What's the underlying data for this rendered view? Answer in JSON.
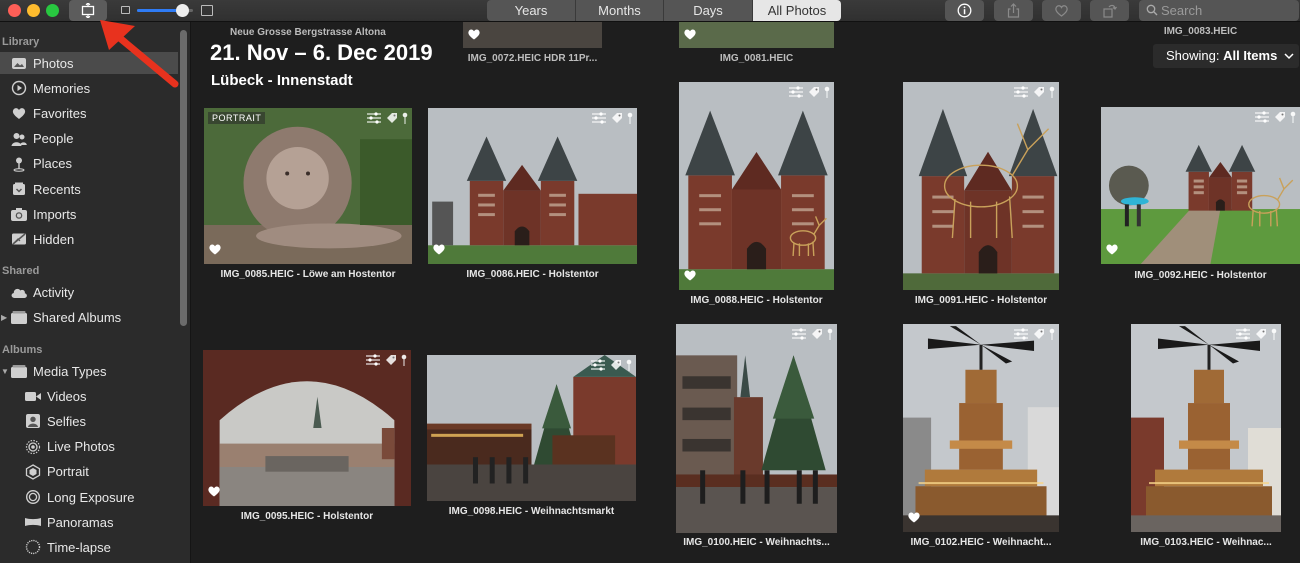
{
  "toolbar": {
    "tabs": [
      {
        "label": "Years",
        "active": false
      },
      {
        "label": "Months",
        "active": false
      },
      {
        "label": "Days",
        "active": false
      },
      {
        "label": "All Photos",
        "active": true
      }
    ],
    "search_placeholder": "Search",
    "zoom_level": 0.8
  },
  "sidebar": {
    "library_header": "Library",
    "library_items": [
      {
        "label": "Photos",
        "icon": "photos-icon",
        "selected": true
      },
      {
        "label": "Memories",
        "icon": "memories-icon"
      },
      {
        "label": "Favorites",
        "icon": "heart-icon"
      },
      {
        "label": "People",
        "icon": "people-icon"
      },
      {
        "label": "Places",
        "icon": "pin-icon"
      },
      {
        "label": "Recents",
        "icon": "recents-icon"
      },
      {
        "label": "Imports",
        "icon": "camera-icon"
      },
      {
        "label": "Hidden",
        "icon": "hidden-icon"
      }
    ],
    "shared_header": "Shared",
    "shared_items": [
      {
        "label": "Activity",
        "icon": "cloud-icon"
      },
      {
        "label": "Shared Albums",
        "icon": "folder-icon",
        "disclosure": true
      }
    ],
    "albums_header": "Albums",
    "albums_items": [
      {
        "label": "Media Types",
        "icon": "folder-icon",
        "disclosure": true,
        "expanded": true
      },
      {
        "label": "Videos",
        "icon": "video-icon",
        "sub": true
      },
      {
        "label": "Selfies",
        "icon": "selfie-icon",
        "sub": true
      },
      {
        "label": "Live Photos",
        "icon": "live-icon",
        "sub": true
      },
      {
        "label": "Portrait",
        "icon": "portrait-icon",
        "sub": true
      },
      {
        "label": "Long Exposure",
        "icon": "exposure-icon",
        "sub": true
      },
      {
        "label": "Panoramas",
        "icon": "panorama-icon",
        "sub": true
      },
      {
        "label": "Time-lapse",
        "icon": "timelapse-icon",
        "sub": true
      }
    ]
  },
  "main": {
    "location_small": "Neue Grosse Bergstrasse Altona",
    "date_range": "21. Nov – 6. Dec 2019",
    "location": "Lübeck - Innenstadt",
    "showing_label": "Showing:",
    "showing_value": "All Items",
    "top_captions": [
      "IMG_0072.HEIC  HDR 11Pr...",
      "IMG_0081.HEIC",
      "IMG_0083.HEIC"
    ],
    "photos": [
      {
        "caption": "IMG_0085.HEIC - Löwe am Hostentor",
        "favorite": true,
        "badge": "PORTRAIT",
        "scene": "lion"
      },
      {
        "caption": "IMG_0086.HEIC - Holstentor",
        "favorite": true,
        "scene": "gate-wide"
      },
      {
        "caption": "IMG_0088.HEIC - Holstentor",
        "favorite": true,
        "scene": "gate-tall"
      },
      {
        "caption": "IMG_0091.HEIC - Holstentor",
        "favorite": false,
        "scene": "gate-deer"
      },
      {
        "caption": "IMG_0092.HEIC - Holstentor",
        "favorite": true,
        "scene": "gate-park"
      },
      {
        "caption": "IMG_0095.HEIC - Holstentor",
        "favorite": true,
        "scene": "arch"
      },
      {
        "caption": "IMG_0098.HEIC - Weihnachtsmarkt",
        "favorite": false,
        "scene": "market"
      },
      {
        "caption": "IMG_0100.HEIC -  Weihnachts...",
        "favorite": false,
        "scene": "tree-street"
      },
      {
        "caption": "IMG_0102.HEIC -  Weihnacht...",
        "favorite": true,
        "scene": "pyramid"
      },
      {
        "caption": "IMG_0103.HEIC -  Weihnac...",
        "favorite": false,
        "scene": "pyramid2"
      }
    ]
  },
  "colors": {
    "accent": "#2f7cf6",
    "annotation_arrow": "#e8321e"
  }
}
